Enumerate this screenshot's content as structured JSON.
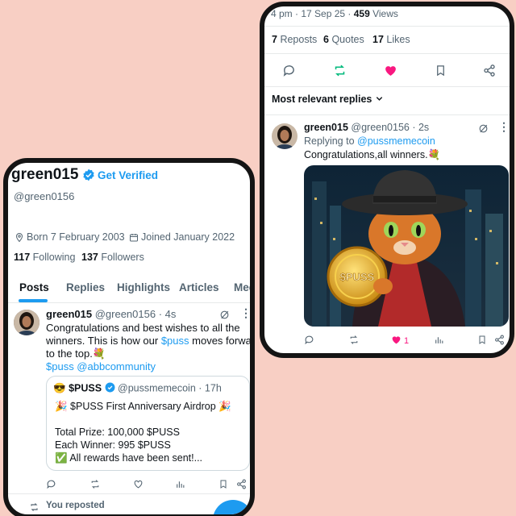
{
  "left": {
    "profile": {
      "name": "green015",
      "get_verified": "Get Verified",
      "handle": "@green0156",
      "born": "Born 7 February 2003",
      "joined": "Joined January 2022",
      "following_count": "117",
      "following_label": "Following",
      "followers_count": "137",
      "followers_label": "Followers"
    },
    "tabs": [
      "Posts",
      "Replies",
      "Highlights",
      "Articles",
      "Med"
    ],
    "post": {
      "name": "green015",
      "handle": "@green0156",
      "time": "· 4s",
      "text_1": "Congratulations and best wishes to all the",
      "text_2a": "winners. This is how our ",
      "text_2b": "$puss",
      "text_2c": " moves forward",
      "text_3": "to the top.💐",
      "text_4": "$puss @abbcommunity",
      "quote": {
        "emoji": "😎",
        "name": "$PUSS",
        "handle": "@pussmemecoin",
        "time": "· 17h",
        "line1": "🎉 $PUSS First Anniversary Airdrop 🎉",
        "line2": "Total Prize: 100,000 $PUSS",
        "line3": "Each Winner: 995 $PUSS",
        "line4": "✅ All rewards have been sent!..."
      }
    },
    "you_reposted": "You reposted"
  },
  "right": {
    "meta": {
      "time": "4 pm · 17 Sep 25 · ",
      "views_count": "459",
      "views_label": " Views"
    },
    "stats": {
      "reposts_count": "7",
      "reposts_label": "Reposts",
      "quotes_count": "6",
      "quotes_label": "Quotes",
      "likes_count": "17",
      "likes_label": "Likes"
    },
    "sort_label": "Most relevant replies",
    "reply": {
      "name": "green015",
      "handle": "@green0156",
      "time": "· 2s",
      "replying_to": "Replying to ",
      "replying_handle": "@pussmemecoin",
      "text": "Congratulations,all winners.💐",
      "image_coin_text": "$PUSS",
      "like_count": "1"
    }
  },
  "colors": {
    "background": "#f8cfc4",
    "accent": "#1d9bf0",
    "like": "#f91880",
    "repost": "#00ba7c"
  }
}
